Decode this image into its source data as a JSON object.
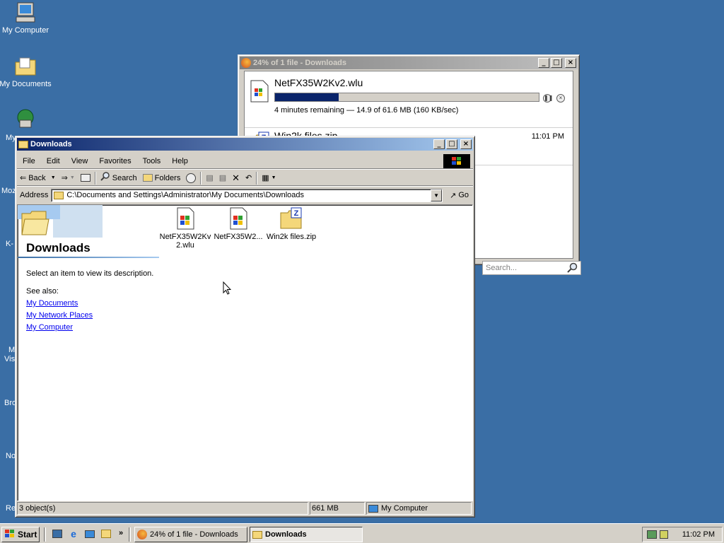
{
  "desktop": {
    "icons": [
      {
        "label": "My Computer",
        "icon": "my-computer-icon"
      },
      {
        "label": "My Documents",
        "icon": "my-documents-icon"
      }
    ],
    "partial_labels": [
      "My",
      "Moz",
      "K-",
      "M",
      "Vis",
      "Bro",
      "No",
      "Re"
    ]
  },
  "download_window": {
    "title": "24% of 1 file - Downloads",
    "items": [
      {
        "name": "NetFX35W2Kv2.wlu",
        "progress_percent": 24,
        "status": "4 minutes remaining — 14.9 of 61.6 MB (160 KB/sec)",
        "icon": "wlu-file-icon"
      },
      {
        "name": "Win2k files.zip",
        "time": "11:01 PM",
        "icon": "zip-file-icon"
      }
    ],
    "search_placeholder": "Search..."
  },
  "explorer": {
    "title": "Downloads",
    "menu": [
      "File",
      "Edit",
      "View",
      "Favorites",
      "Tools",
      "Help"
    ],
    "toolbar": {
      "back": "Back",
      "search": "Search",
      "folders": "Folders"
    },
    "address_label": "Address",
    "address": "C:\\Documents and Settings\\Administrator\\My Documents\\Downloads",
    "go": "Go",
    "panel": {
      "title": "Downloads",
      "description": "Select an item to view its description.",
      "see_also": "See also:",
      "links": [
        "My Documents",
        "My Network Places",
        "My Computer"
      ]
    },
    "files": [
      {
        "line1": "NetFX35W2Kv",
        "line2": "2.wlu",
        "icon": "wlu-file-icon"
      },
      {
        "line1": "NetFX35W2...",
        "line2": "",
        "icon": "wlu-file-icon"
      },
      {
        "line1": "Win2k files.zip",
        "line2": "",
        "icon": "zip-file-icon"
      }
    ],
    "status": {
      "objects": "3 object(s)",
      "size": "661 MB",
      "location": "My Computer"
    }
  },
  "taskbar": {
    "start": "Start",
    "tasks": [
      {
        "label": "24% of 1 file - Downloads",
        "active": false
      },
      {
        "label": "Downloads",
        "active": true
      }
    ],
    "clock": "11:02 PM"
  },
  "colors": {
    "desktop": "#3a6ea5",
    "titlebar_active": "#0a246a",
    "progress": "#0a246a",
    "link": "#0000ee"
  }
}
